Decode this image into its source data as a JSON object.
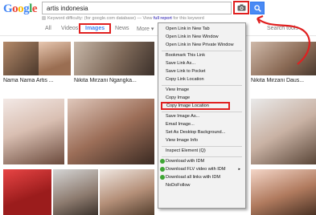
{
  "logo": {
    "letters": [
      "G",
      "o",
      "o",
      "g",
      "l",
      "e"
    ],
    "colors": [
      "#4285f4",
      "#ea4335",
      "#fbbc05",
      "#4285f4",
      "#34a853",
      "#ea4335"
    ]
  },
  "search": {
    "query": "artis indonesia"
  },
  "keyword_row": {
    "prefix": "Keyword difficulty: ",
    "note": "(for google.com database) — View ",
    "link": "full report",
    "suffix": " for this keyword"
  },
  "tabs": {
    "all": "All",
    "videos": "Videos",
    "images": "Images",
    "news": "News",
    "more": "More ▾",
    "search_tools": "Search tools"
  },
  "captions": [
    "Nama Nama Artis ...",
    "Nikita Mirzani Ngangka...",
    "Nikita Mirzani Daus..."
  ],
  "context_menu": {
    "items": [
      "Open Link in New Tab",
      "Open Link in New Window",
      "Open Link in New Private Window",
      "Bookmark This Link",
      "Save Link As...",
      "Save Link to Pocket",
      "Copy Link Location",
      "View Image",
      "Copy Image",
      "Copy Image Location",
      "Save Image As...",
      "Email Image...",
      "Set As Desktop Background...",
      "View Image Info",
      "Inspect Element (Q)",
      "Download with IDM",
      "Download FLV video with IDM",
      "Download all links with IDM",
      "NoDoFollow"
    ]
  },
  "colors": {
    "highlight": "#e02020",
    "accent": "#4285f4",
    "menu_bg": "#f2f2f2"
  }
}
